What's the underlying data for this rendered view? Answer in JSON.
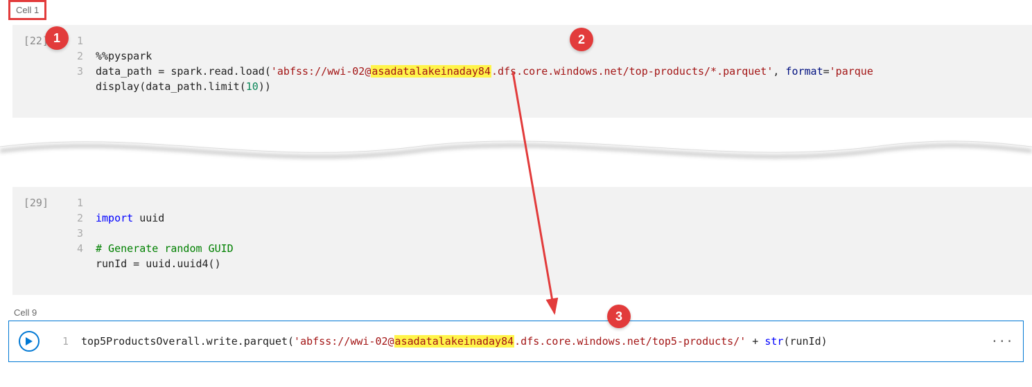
{
  "cell1": {
    "label": "Cell 1",
    "exec": "[22]",
    "line_nos": [
      "1",
      "2",
      "3"
    ],
    "code": {
      "l1": "%%pyspark",
      "l2_a": "data_path = spark.read.load(",
      "l2_str1": "'abfss://wwi-02@",
      "l2_hl": "asadatalakeinaday84",
      "l2_str2": ".dfs.core.windows.net/top-products/*.parquet'",
      "l2_comma": ", ",
      "l2_argn": "format",
      "l2_eq": "=",
      "l2_str3": "'parque",
      "l3_a": "display(data_path.limit(",
      "l3_n": "10",
      "l3_b": "))"
    }
  },
  "cellMid": {
    "exec": "[29]",
    "line_nos": [
      "1",
      "2",
      "3",
      "4"
    ],
    "code": {
      "l1_kw": "import",
      "l1_mod": " uuid",
      "l3": "# Generate random GUID",
      "l4": "runId = uuid.uuid4()"
    }
  },
  "cell9": {
    "label": "Cell 9",
    "line_no": "1",
    "code": {
      "a": "top5ProductsOverall.write.parquet(",
      "str1": "'abfss://wwi-02@",
      "hl": "asadatalakeinaday84",
      "str2": ".dfs.core.windows.net/top5-products/'",
      "plus": " + ",
      "fn": "str",
      "paren": "(runId)"
    },
    "ellipsis": "···"
  },
  "callouts": {
    "c1": "1",
    "c2": "2",
    "c3": "3"
  }
}
